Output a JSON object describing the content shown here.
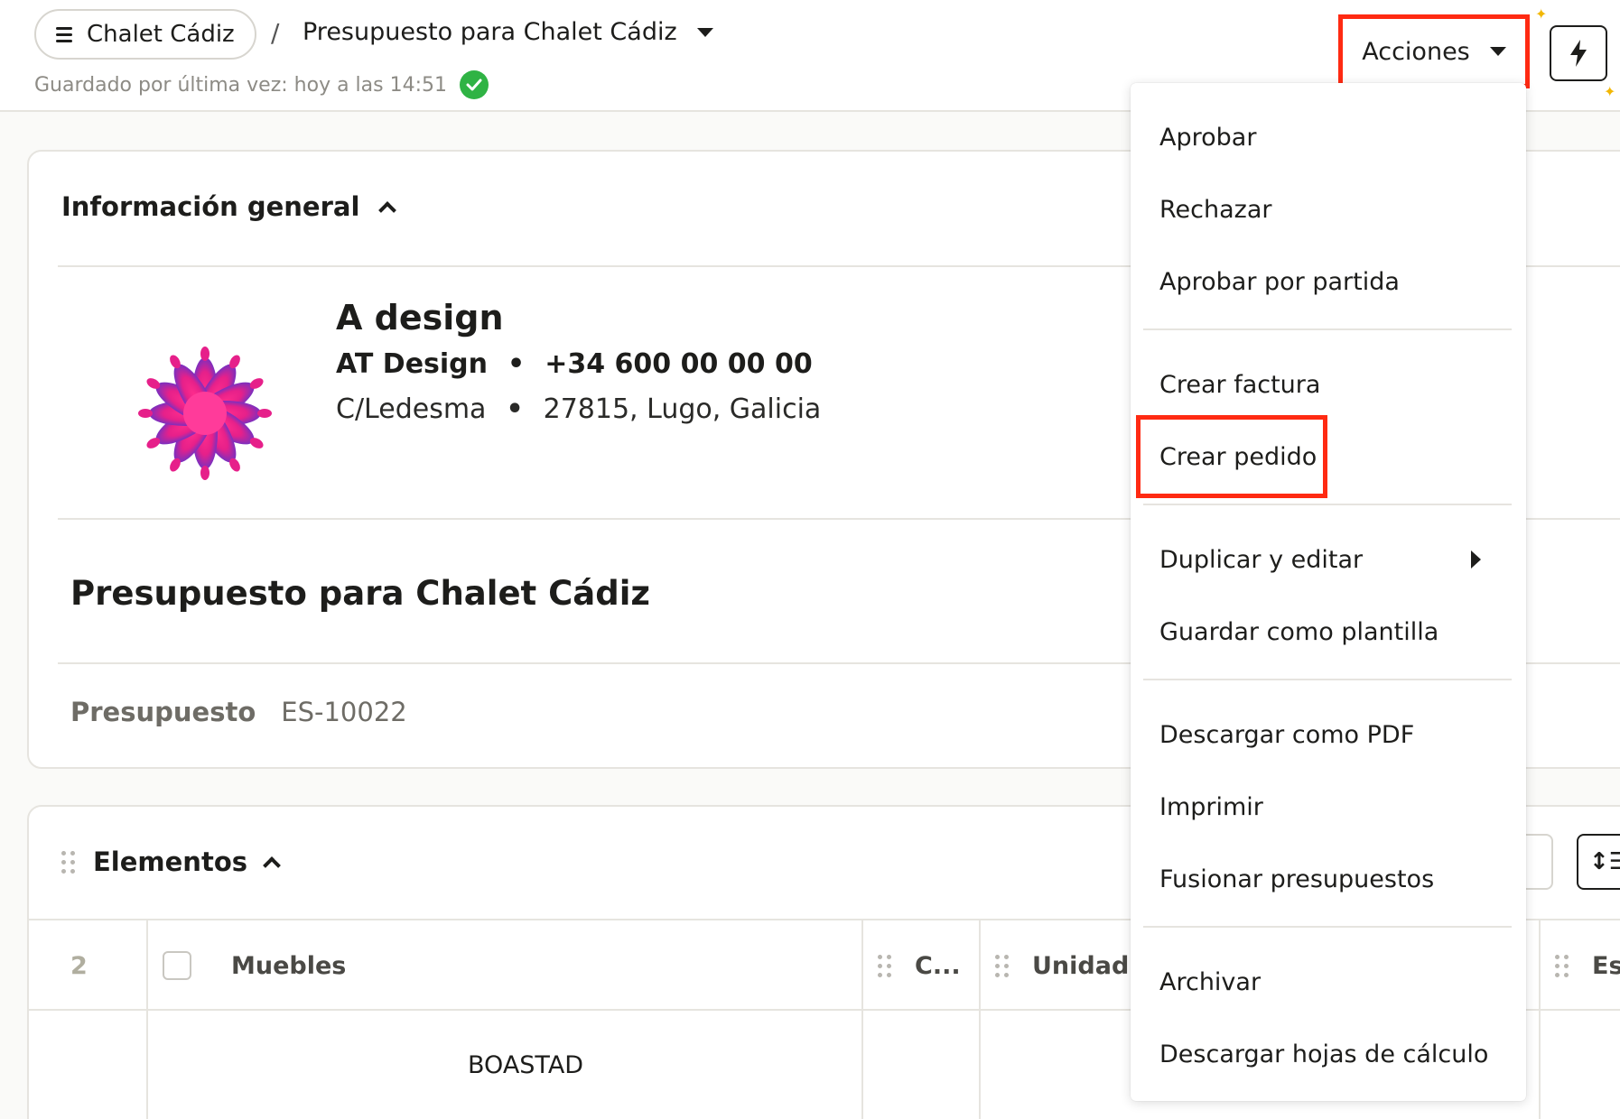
{
  "header": {
    "project_label": "Chalet Cádiz",
    "separator": "/",
    "document_title": "Presupuesto para Chalet Cádiz",
    "saved_text": "Guardado por última vez: hoy a las 14:51",
    "actions_label": "Acciones"
  },
  "info": {
    "section_title": "Información general",
    "company_name": "A design",
    "company_legal": "AT Design",
    "phone": "+34 600 00 00 00",
    "street": "C/Ledesma",
    "city_line": "27815, Lugo, Galicia",
    "quote_title": "Presupuesto para Chalet Cádiz",
    "ref_label": "Presupuesto",
    "ref_value": "ES-10022"
  },
  "elements": {
    "section_title": "Elementos",
    "row_count": "2",
    "group_name": "Muebles",
    "col_c": "C...",
    "col_unidad": "Unidad",
    "col_es": "Es...",
    "first_item": "BOASTAD"
  },
  "menu": {
    "items": [
      "Aprobar",
      "Rechazar",
      "Aprobar por partida",
      "Crear factura",
      "Crear pedido",
      "Duplicar y editar",
      "Guardar como plantilla",
      "Descargar como PDF",
      "Imprimir",
      "Fusionar presupuestos",
      "Archivar",
      "Descargar hojas de cálculo"
    ]
  },
  "colors": {
    "highlight": "#ff2a12",
    "success": "#2fb344",
    "logo_primary": "#e6208a",
    "logo_secondary": "#7b2fbf"
  },
  "icons": [
    "menu-icon",
    "caret-down-icon",
    "check-circle-icon",
    "bolt-icon",
    "chevron-up-icon",
    "drag-handle-icon",
    "submenu-arrow-icon",
    "lotus-logo"
  ]
}
